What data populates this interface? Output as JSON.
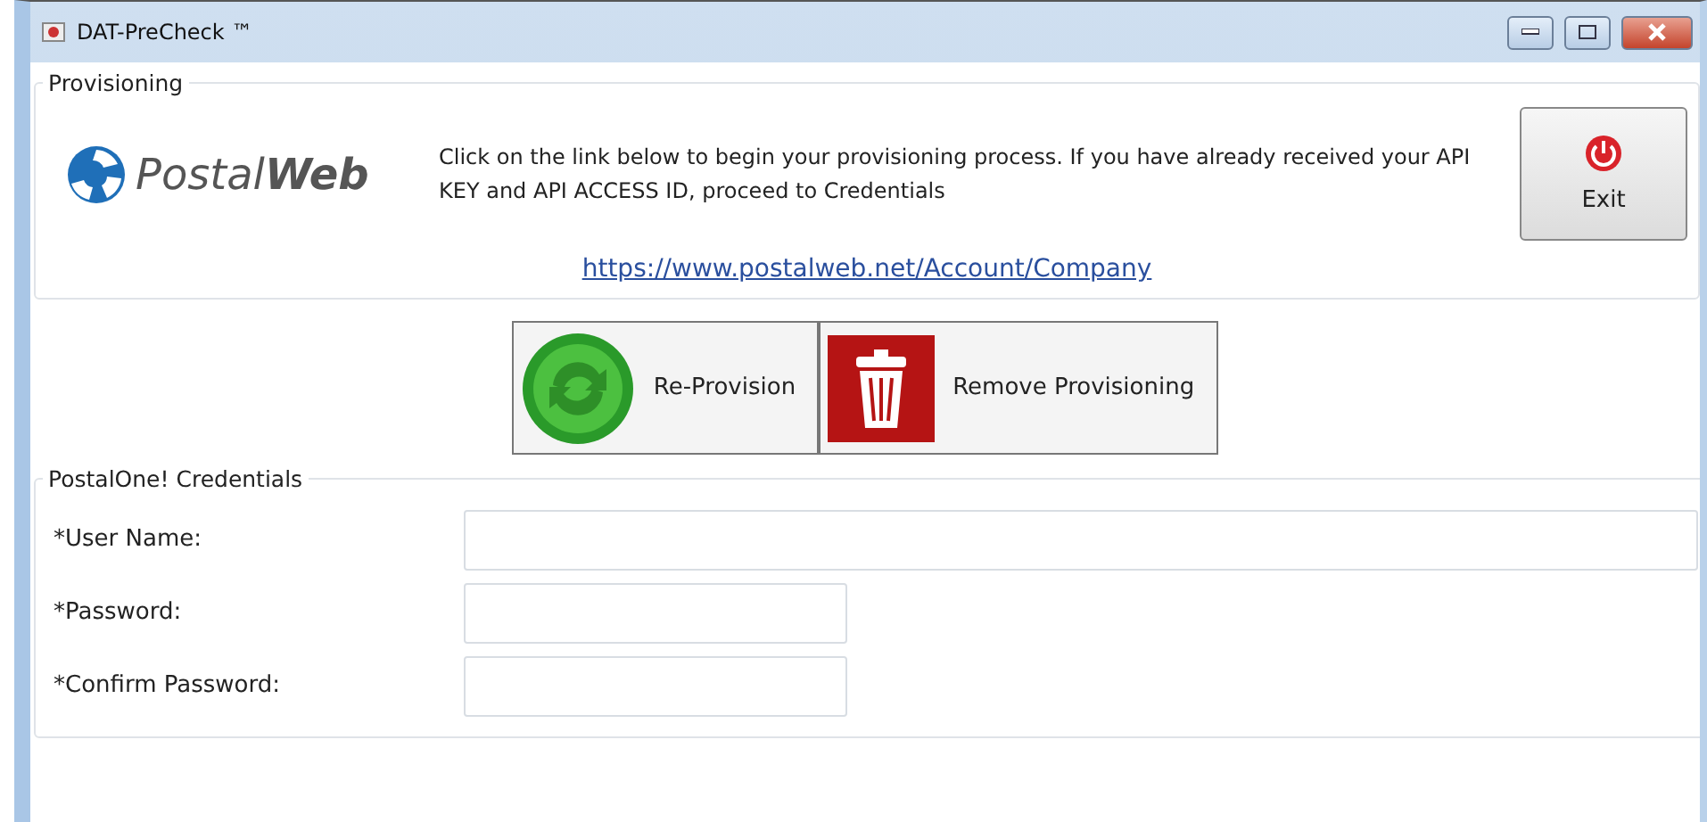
{
  "window": {
    "title": "DAT-PreCheck ™"
  },
  "provisioning": {
    "legend": "Provisioning",
    "logo": "Postal**Web**",
    "instructions": "Click on the link below to begin your provisioning process.  If you have already received your API KEY and API ACCESS ID, proceed to Credentials",
    "link": "https://www.postalweb.net/Account/Company",
    "exit_button": "Exit"
  },
  "actions": [
    {
      "kind": "reprovision",
      "label": "Re-Provision"
    },
    {
      "kind": "remove",
      "label": "Remove Provisioning"
    }
  ],
  "credentials": {
    "legend": "PostalOne! Credentials",
    "fields": [
      {
        "label": "*User Name:",
        "kind": "wide"
      },
      {
        "label": "*Password:",
        "kind": "narrow"
      },
      {
        "label": "*Confirm Password:",
        "kind": "narrow"
      }
    ]
  }
}
